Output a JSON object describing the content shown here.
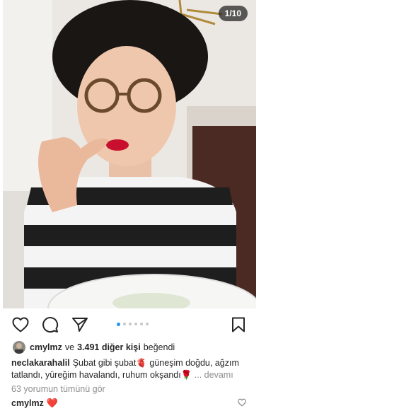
{
  "post": {
    "slide_counter": "1/10",
    "carousel": {
      "total": 6,
      "active_index": 0
    },
    "likes": {
      "user": "cmylmz",
      "connector": "ve",
      "count_text": "3.491 diğer kişi",
      "suffix": "beğendi"
    },
    "caption": {
      "user": "neclakarahalil",
      "text": "Şubat gibi şubat🫀 güneşim doğdu, ağzım tatlandı, yüreğim havalandı, ruhum okşandı🌹",
      "more": "... devamı"
    },
    "view_comments": "63 yorumun tümünü gör",
    "comment": {
      "user": "cmylmz",
      "text": "❤️"
    }
  },
  "icons": {
    "like": "heart-outline-icon",
    "comment": "speech-bubble-icon",
    "share": "paper-plane-icon",
    "save": "bookmark-icon",
    "comment_like": "small-heart-icon"
  }
}
